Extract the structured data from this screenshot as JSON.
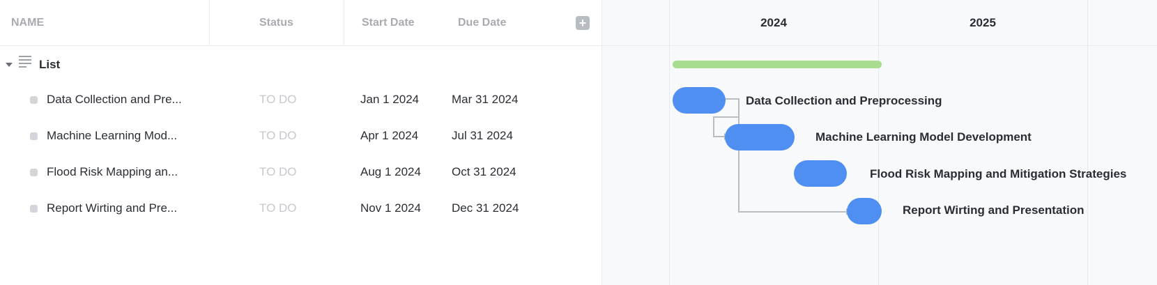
{
  "columns": {
    "name": "NAME",
    "status": "Status",
    "start": "Start Date",
    "due": "Due Date",
    "add_icon": "plus-icon"
  },
  "group": {
    "label": "List"
  },
  "tasks": [
    {
      "name": "Data Collection and Pre...",
      "status": "TO DO",
      "start": "Jan 1 2024",
      "due": "Mar 31 2024",
      "full": "Data Collection and Preprocessing"
    },
    {
      "name": "Machine Learning Mod...",
      "status": "TO DO",
      "start": "Apr 1 2024",
      "due": "Jul 31 2024",
      "full": "Machine Learning Model Development"
    },
    {
      "name": "Flood Risk Mapping an...",
      "status": "TO DO",
      "start": "Aug 1 2024",
      "due": "Oct 31 2024",
      "full": "Flood Risk Mapping and Mitigation Strategies"
    },
    {
      "name": "Report Wirting and Pre...",
      "status": "TO DO",
      "start": "Nov 1 2024",
      "due": "Dec 31 2024",
      "full": "Report Wirting and Presentation"
    }
  ],
  "timeline": {
    "years": [
      "2024",
      "2025"
    ],
    "bar_color": "#4f8ff2",
    "summary_color": "#a8dc8e"
  }
}
